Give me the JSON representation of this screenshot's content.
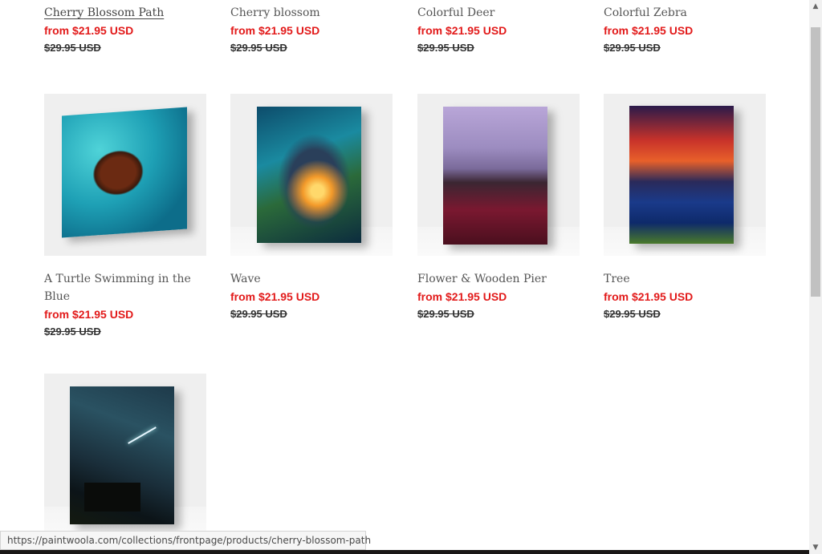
{
  "colors": {
    "sale_price": "#e21a1a",
    "old_price": "#333333",
    "title": "#555555"
  },
  "top_row": [
    {
      "title": "Cherry Blossom Path",
      "sale": "from $21.95 USD",
      "old": "$29.95 USD"
    },
    {
      "title": "Cherry blossom",
      "sale": "from $21.95 USD",
      "old": "$29.95 USD"
    },
    {
      "title": "Colorful Deer",
      "sale": "from $21.95 USD",
      "old": "$29.95 USD"
    },
    {
      "title": "Colorful Zebra",
      "sale": "from $21.95 USD",
      "old": "$29.95 USD"
    }
  ],
  "products": [
    {
      "title": "A Turtle Swimming in the Blue",
      "sale": "from $21.95 USD",
      "old": "$29.95 USD",
      "image": "turtle painting"
    },
    {
      "title": "Wave",
      "sale": "from $21.95 USD",
      "old": "$29.95 USD",
      "image": "ocean wave sunset painting"
    },
    {
      "title": "Flower & Wooden Pier",
      "sale": "from $21.95 USD",
      "old": "$29.95 USD",
      "image": "pier with red flowers painting"
    },
    {
      "title": "Tree",
      "sale": "from $21.95 USD",
      "old": "$29.95 USD",
      "image": "red sky tree painting"
    },
    {
      "title": "",
      "sale": "",
      "old": "",
      "image": "night sky church painting"
    }
  ],
  "status_bar": {
    "url": "https://paintwoola.com/collections/frontpage/products/cherry-blossom-path"
  }
}
